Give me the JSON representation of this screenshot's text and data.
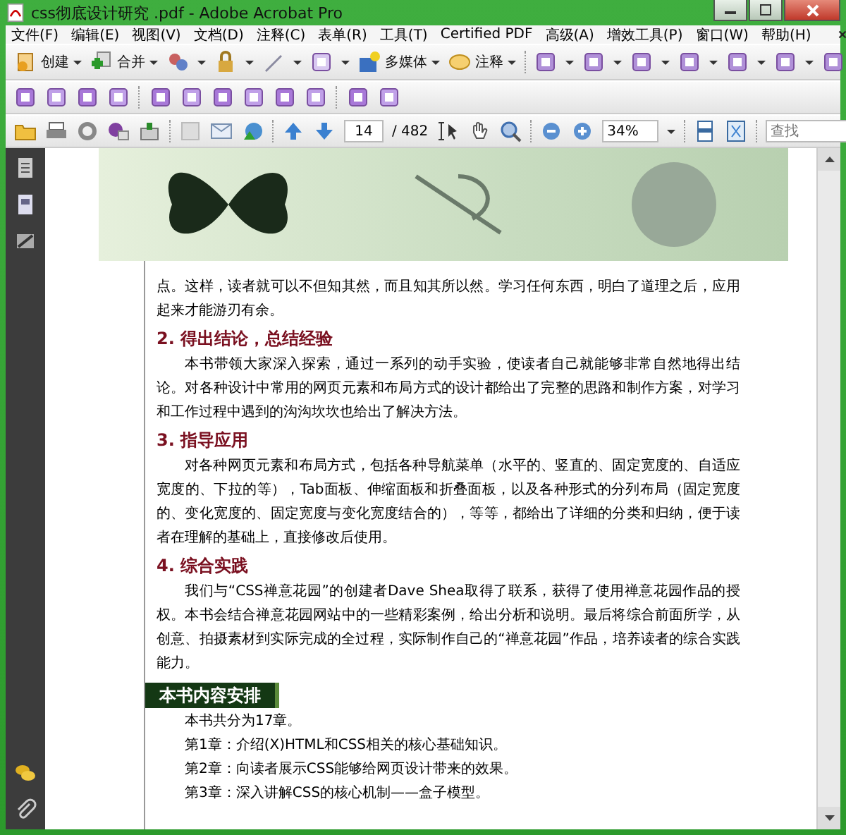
{
  "window": {
    "title": "css彻底设计研究 .pdf - Adobe Acrobat Pro"
  },
  "menu": [
    "文件(F)",
    "编辑(E)",
    "视图(V)",
    "文档(D)",
    "注释(C)",
    "表单(R)",
    "工具(T)",
    "Certified PDF",
    "高级(A)",
    "增效工具(P)",
    "窗口(W)",
    "帮助(H)"
  ],
  "toolbar_labels": [
    "创建",
    "合并",
    "多媒体",
    "注释"
  ],
  "navigation": {
    "page": "14",
    "total": "/ 482",
    "zoom": "34%",
    "search_placeholder": "查找"
  },
  "document": [
    {
      "kind": "para",
      "indent": false,
      "text": "点。这样，读者就可以不但知其然，而且知其所以然。学习任何东西，明白了道理之后，应用起来才能游刃有余。"
    },
    {
      "kind": "heading",
      "text": "2. 得出结论，总结经验"
    },
    {
      "kind": "para",
      "indent": true,
      "text": "本书带领大家深入探索，通过一系列的动手实验，使读者自己就能够非常自然地得出结论。对各种设计中常用的网页元素和布局方式的设计都给出了完整的思路和制作方案，对学习和工作过程中遇到的沟沟坎坎也给出了解决方法。"
    },
    {
      "kind": "heading",
      "text": "3. 指导应用"
    },
    {
      "kind": "para",
      "indent": true,
      "text": "对各种网页元素和布局方式，包括各种导航菜单（水平的、竖直的、固定宽度的、自适应宽度的、下拉的等），Tab面板、伸缩面板和折叠面板，以及各种形式的分列布局（固定宽度的、变化宽度的、固定宽度与变化宽度结合的），等等，都给出了详细的分类和归纳，便于读者在理解的基础上，直接修改后使用。"
    },
    {
      "kind": "heading",
      "text": "4. 综合实践"
    },
    {
      "kind": "para",
      "indent": true,
      "text": "我们与“CSS禅意花园”的创建者Dave Shea取得了联系，获得了使用禅意花园作品的授权。本书会结合禅意花园网站中的一些精彩案例，给出分析和说明。最后将综合前面所学，从创意、拍摄素材到实际完成的全过程，实际制作自己的“禅意花园”作品，培养读者的综合实践能力。"
    },
    {
      "kind": "banner",
      "text": "本书内容安排"
    },
    {
      "kind": "item",
      "text": "本书共分为17章。"
    },
    {
      "kind": "item",
      "text": "第1章：介绍(X)HTML和CSS相关的核心基础知识。"
    },
    {
      "kind": "item",
      "text": "第2章：向读者展示CSS能够给网页设计带来的效果。"
    },
    {
      "kind": "item",
      "text": "第3章：深入讲解CSS的核心机制——盒子模型。"
    }
  ]
}
